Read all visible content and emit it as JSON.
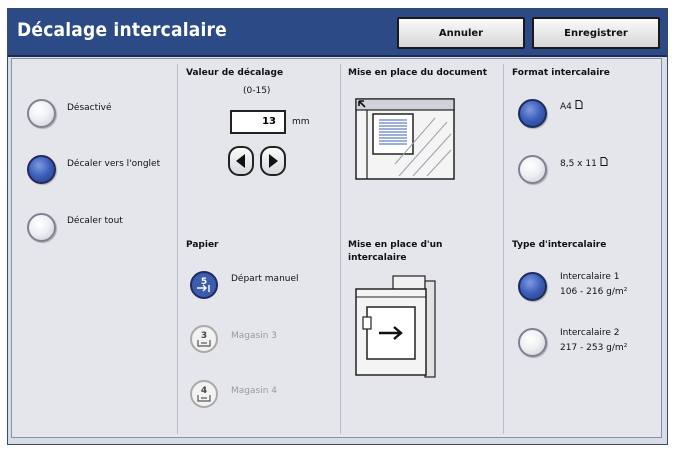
{
  "header": {
    "title": "Décalage intercalaire",
    "cancel_label": "Annuler",
    "save_label": "Enregistrer"
  },
  "offset_options": [
    {
      "label": "Désactivé",
      "selected": false
    },
    {
      "label": "Décaler vers l'onglet",
      "selected": true
    },
    {
      "label": "Décaler tout",
      "selected": false
    }
  ],
  "offset_value": {
    "heading": "Valeur de décalage",
    "range": "(0-15)",
    "value": "13",
    "unit": "mm"
  },
  "paper": {
    "heading": "Papier",
    "items": [
      {
        "label": "Départ manuel",
        "tray_number": "5",
        "enabled": true,
        "selected": true
      },
      {
        "label": "Magasin 3",
        "tray_number": "3",
        "enabled": false,
        "selected": false
      },
      {
        "label": "Magasin 4",
        "tray_number": "4",
        "enabled": false,
        "selected": false
      }
    ]
  },
  "document_placement": {
    "heading": "Mise en place du document"
  },
  "tab_placement": {
    "heading": "Mise en place d'un intercalaire"
  },
  "tab_format": {
    "heading": "Format intercalaire",
    "options": [
      {
        "label": "A4",
        "selected": true
      },
      {
        "label": "8,5 x 11",
        "selected": false
      }
    ]
  },
  "tab_type": {
    "heading": "Type d'intercalaire",
    "options": [
      {
        "line1": "Intercalaire 1",
        "line2": "106 - 216 g/m²",
        "selected": true
      },
      {
        "line1": "Intercalaire 2",
        "line2": "217 - 253 g/m²",
        "selected": false
      }
    ]
  }
}
